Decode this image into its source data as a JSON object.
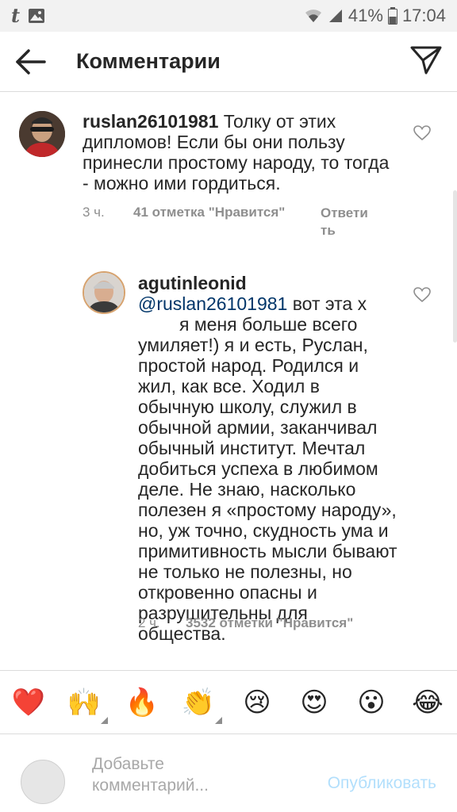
{
  "status_bar": {
    "battery": "41%",
    "time": "17:04",
    "icons": [
      "tumblr-icon",
      "image-icon",
      "wifi-icon",
      "signal-icon",
      "battery-icon"
    ]
  },
  "header": {
    "title": "Комментарии"
  },
  "comments": [
    {
      "username": "ruslan26101981",
      "text": "Толку от этих дипломов! Если бы они пользу принесли простому народу, то тогда - можно ими гордиться.",
      "time": "3 ч.",
      "likes": "41 отметка \"Нравится\"",
      "reply_line1": "Ответи",
      "reply_line2": "ть"
    },
    {
      "username": "agutinleonid",
      "mention": "@ruslan26101981",
      "text_before_gap": "вот эта х",
      "text_after_gap": "я меня больше всего умиляет!) я и есть, Руслан, простой народ. Родился и жил, как все. Ходил в обычную школу, служил в обычной армии, заканчивал обычный институт. Мечтал добиться успеха в любимом деле. Не знаю, насколько полезен я «простому народу», но, уж точно, скудность ума и примитивность мысли бывают не только не полезны, но откровенно опасны и разрушительны для общества.",
      "time": "2 ч.",
      "likes": "3532 отметки \"Нравится\""
    }
  ],
  "reactions": [
    "❤️",
    "🙌",
    "🔥",
    "👏",
    "😢",
    "😍",
    "😮",
    "😂"
  ],
  "input": {
    "placeholder_line1": "Добавьте",
    "placeholder_line2": "комментарий...",
    "publish": "Опубликовать"
  },
  "colors": {
    "accent_blue": "#3897f0",
    "publish_disabled": "#b2dffc",
    "mention": "#003569",
    "heart_red": "#ed4956"
  }
}
